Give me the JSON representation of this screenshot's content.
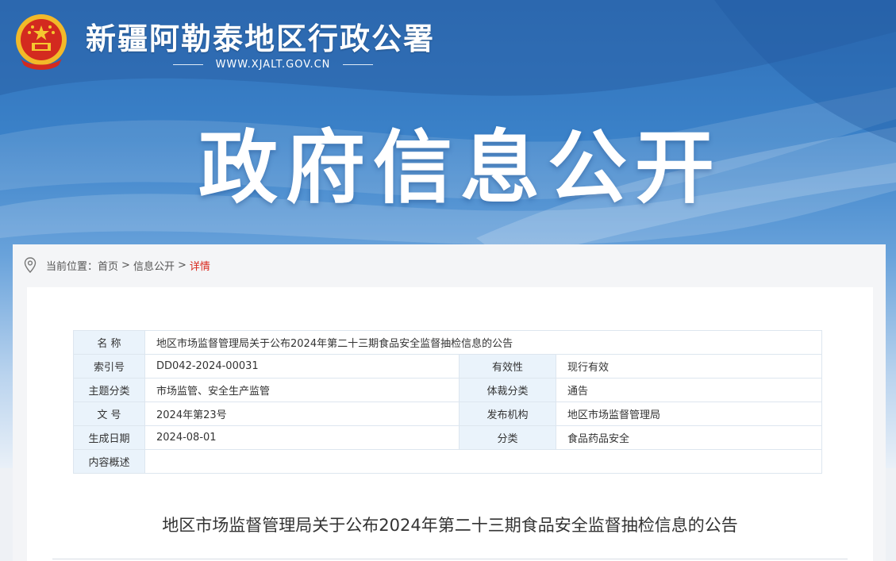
{
  "header": {
    "site_title": "新疆阿勒泰地区行政公署",
    "site_url": "WWW.XJALT.GOV.CN",
    "hero_title": "政府信息公开",
    "emblem_icon": "national-emblem-icon"
  },
  "breadcrumb": {
    "prefix": "当前位置：",
    "items": [
      "首页",
      "信息公开"
    ],
    "separator": ">",
    "current": "详情",
    "icon": "location-pin-icon"
  },
  "meta": {
    "name_label": "名 称",
    "name_value": "地区市场监督管理局关于公布2024年第二十三期食品安全监督抽检信息的公告",
    "rows": [
      {
        "l1": "索引号",
        "v1": "DD042-2024-00031",
        "l2": "有效性",
        "v2": "现行有效"
      },
      {
        "l1": "主题分类",
        "v1": "市场监管、安全生产监管",
        "l2": "体裁分类",
        "v2": "通告"
      },
      {
        "l1": "文 号",
        "v1": "2024年第23号",
        "l2": "发布机构",
        "v2": "地区市场监督管理局"
      },
      {
        "l1": "生成日期",
        "v1": "2024-08-01",
        "l2": "分类",
        "v2": "食品药品安全"
      }
    ],
    "summary_label": "内容概述",
    "summary_value": ""
  },
  "document": {
    "title": "地区市场监督管理局关于公布2024年第二十三期食品安全监督抽检信息的公告"
  },
  "colors": {
    "banner_top": "#2f6fb8",
    "label_bg": "#eaf3fb",
    "breadcrumb_current": "#d9271c"
  }
}
